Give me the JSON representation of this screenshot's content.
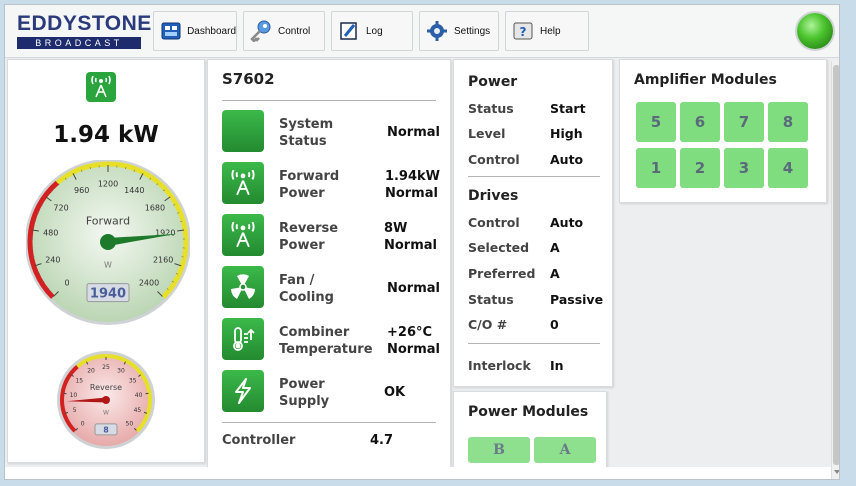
{
  "brand": {
    "name": "EDDYSTONE",
    "tagline": "BROADCAST"
  },
  "nav": {
    "dashboard": "Dashboard",
    "control": "Control",
    "log": "Log",
    "settings": "Settings",
    "help": "Help"
  },
  "meters": {
    "forward_power": "1.94 kW",
    "forward_gauge": {
      "label": "Forward",
      "unit": "W",
      "ticks": [
        "0",
        "240",
        "480",
        "720",
        "960",
        "1200",
        "1440",
        "1680",
        "1920",
        "2160",
        "2400"
      ],
      "readout": "1940",
      "value": 1940,
      "max": 2400
    },
    "reverse_gauge": {
      "label": "Reverse",
      "unit": "W",
      "ticks": [
        "0",
        "5",
        "10",
        "15",
        "20",
        "25",
        "30",
        "35",
        "40",
        "45",
        "50"
      ],
      "readout": "8",
      "value": 8,
      "max": 50
    }
  },
  "system": {
    "title": "S7602",
    "rows": [
      {
        "label1": "System",
        "label2": "Status",
        "value1": "Normal",
        "value2": ""
      },
      {
        "label1": "Forward",
        "label2": "Power",
        "value1": "1.94kW",
        "value2": "Normal"
      },
      {
        "label1": "Reverse",
        "label2": "Power",
        "value1": "8W",
        "value2": "Normal"
      },
      {
        "label1": "Fan /",
        "label2": "Cooling",
        "value1": "Normal",
        "value2": ""
      },
      {
        "label1": "Combiner",
        "label2": "Temperature",
        "value1": "+26°C",
        "value2": "Normal"
      },
      {
        "label1": "Power",
        "label2": "Supply",
        "value1": "OK",
        "value2": ""
      }
    ],
    "controller_label": "Controller",
    "controller_value": "4.7"
  },
  "power": {
    "title": "Power",
    "status_label": "Status",
    "status_value": "Start",
    "level_label": "Level",
    "level_value": "High",
    "control_label": "Control",
    "control_value": "Auto"
  },
  "drives": {
    "title": "Drives",
    "control_label": "Control",
    "control_value": "Auto",
    "selected_label": "Selected",
    "selected_value": "A",
    "preferred_label": "Preferred",
    "preferred_value": "A",
    "status_label": "Status",
    "status_value": "Passive",
    "co_label": "C/O #",
    "co_value": "0",
    "interlock_label": "Interlock",
    "interlock_value": "In"
  },
  "amplifier_modules": {
    "title": "Amplifier Modules",
    "modules": [
      "5",
      "6",
      "7",
      "8",
      "1",
      "2",
      "3",
      "4"
    ]
  },
  "power_modules": {
    "title": "Power Modules",
    "modules": [
      "B",
      "A"
    ]
  },
  "colors": {
    "module_ok": "#7fdc7f",
    "status_green": "#2aa43c",
    "brand_navy": "#1e2c6d"
  }
}
